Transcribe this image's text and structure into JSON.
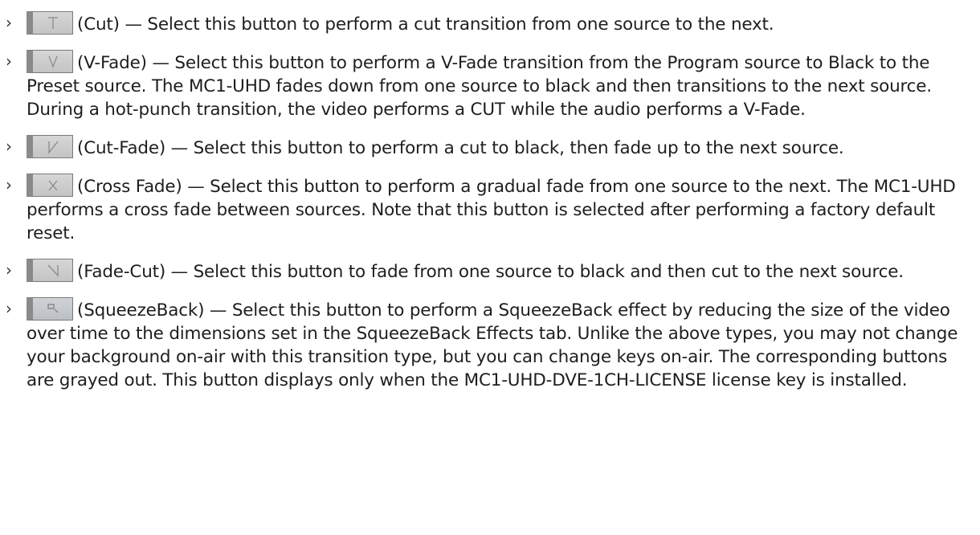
{
  "items": [
    {
      "icon": "cut-transition-icon",
      "text": "(Cut) — Select this button to perform a cut transition from one source to the next."
    },
    {
      "icon": "v-fade-transition-icon",
      "text": "(V-Fade) — Select this button to perform a V-Fade transition from the Program source to Black to the Preset source. The MC1-UHD fades down from one source to black and then transitions to the next source. During a hot-punch transition, the video performs a CUT while the audio performs a V-Fade."
    },
    {
      "icon": "cut-fade-transition-icon",
      "text": "(Cut-Fade) — Select this button to perform a cut to black, then fade up to the next source."
    },
    {
      "icon": "cross-fade-transition-icon",
      "text": "(Cross Fade) — Select this button to perform a gradual fade from one source to the next. The MC1-UHD performs a cross fade between sources. Note that this button is selected after performing a factory default reset."
    },
    {
      "icon": "fade-cut-transition-icon",
      "text": "(Fade-Cut) — Select this button to fade from one source to black and then cut to the next source."
    },
    {
      "icon": "squeezeback-transition-icon",
      "text": "(SqueezeBack) — Select this button to perform a SqueezeBack effect by reducing the size of the video over time to the dimensions set in the SqueezeBack Effects tab. Unlike the above types, you may not change your background on-air with this transition type, but you can change keys on-air. The corresponding buttons are grayed out. This button displays only when the MC1-UHD-DVE-1CH-LICENSE license key is installed."
    }
  ]
}
